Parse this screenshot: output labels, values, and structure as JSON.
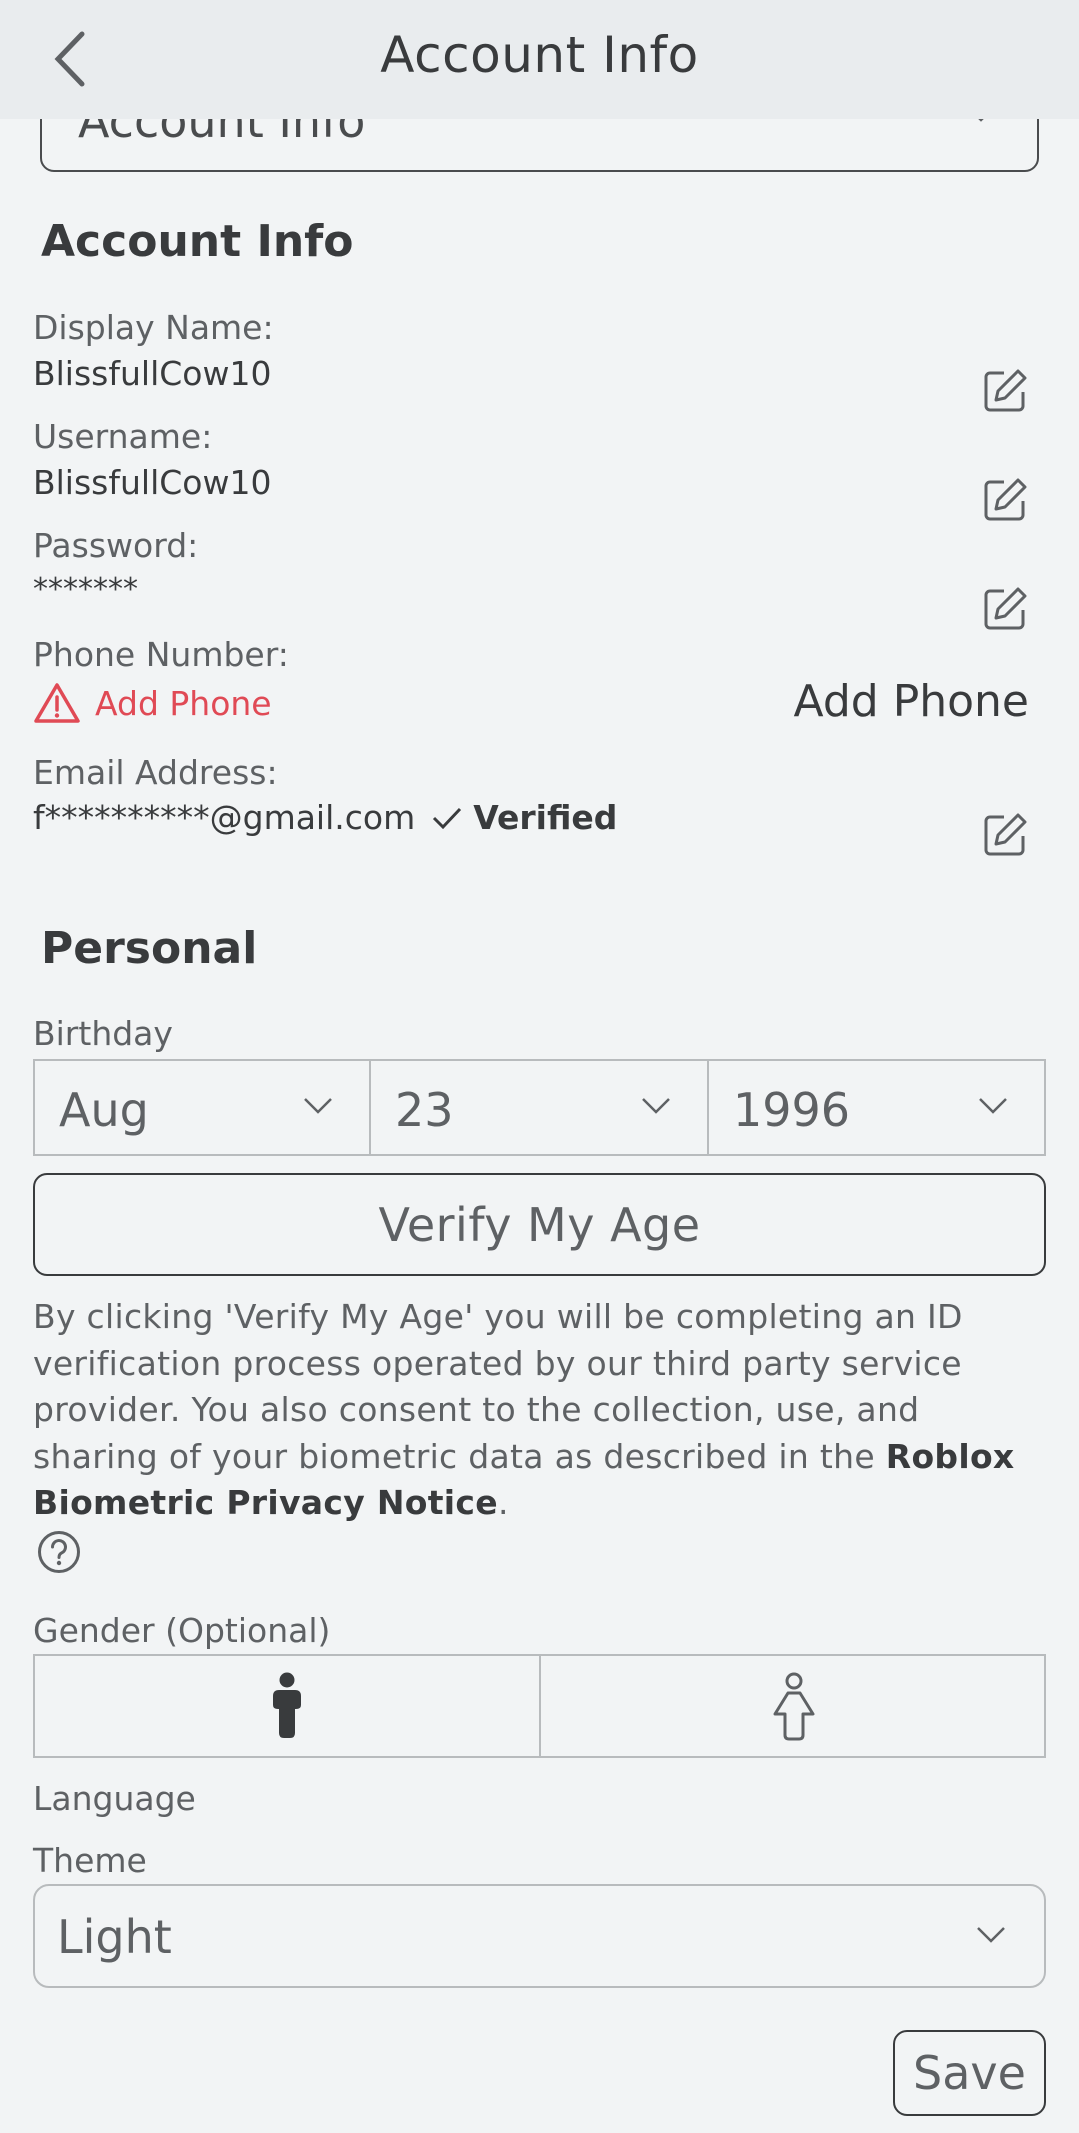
{
  "header": {
    "title": "Account Info"
  },
  "top_dropdown": {
    "label": "Account Info"
  },
  "account_section": {
    "title": "Account Info",
    "display_name_label": "Display Name:",
    "display_name_value": "BlissfullCow10",
    "username_label": "Username:",
    "username_value": "BlissfullCow10",
    "password_label": "Password:",
    "password_value": "*******",
    "phone_label": "Phone Number:",
    "phone_warning": "Add Phone",
    "phone_action": "Add Phone",
    "email_label": "Email Address:",
    "email_value": "f**********@gmail.com",
    "email_status": "Verified"
  },
  "personal_section": {
    "title": "Personal",
    "birthday_label": "Birthday",
    "birthday": {
      "month": "Aug",
      "day": "23",
      "year": "1996"
    },
    "verify_button": "Verify My Age",
    "disclaimer_text": "By clicking 'Verify My Age' you will be completing an ID verification process operated by our third party service provider. You also consent to the collection, use, and sharing of your biometric data as described in the ",
    "disclaimer_link": "Roblox Biometric Privacy Notice",
    "disclaimer_end": ".",
    "gender_label": "Gender (Optional)",
    "language_label": "Language",
    "theme_label": "Theme",
    "theme_value": "Light",
    "save_button": "Save"
  },
  "colors": {
    "background": "#f2f4f5",
    "header_bg": "#e9ecee",
    "text_primary": "#393b3d",
    "text_secondary": "#5e6164",
    "warning": "#e04a55",
    "border": "#b8bbbd"
  }
}
